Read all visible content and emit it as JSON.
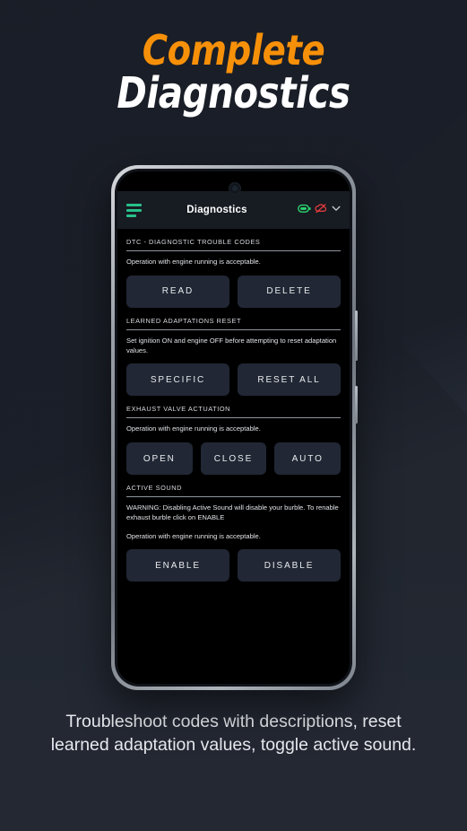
{
  "headline": {
    "line1": "Complete",
    "line2": "Diagnostics",
    "accent_color": "#F79009",
    "line2_color": "#FFFFFF"
  },
  "caption": "Troubleshoot codes with descriptions, reset learned adaptation values, toggle active sound.",
  "phone": {
    "app_bar": {
      "menu_icon": "hamburger-menu-icon",
      "menu_color": "#27C08A",
      "title": "Diagnostics",
      "status_icons": [
        {
          "name": "battery-icon",
          "color": "#2BD46F"
        },
        {
          "name": "cloud-off-icon",
          "color": "#E03C3C"
        },
        {
          "name": "chevron-down-icon",
          "color": "#C9CCD2"
        }
      ]
    },
    "sections": [
      {
        "title": "DTC - DIAGNOSTIC TROUBLE CODES",
        "description": "Operation with engine running is acceptable.",
        "warning": "",
        "buttons": [
          "READ",
          "DELETE"
        ]
      },
      {
        "title": "LEARNED ADAPTATIONS RESET",
        "description": "Set ignition ON and engine OFF before attempting to reset adaptation values.",
        "warning": "",
        "buttons": [
          "SPECIFIC",
          "RESET ALL"
        ]
      },
      {
        "title": "EXHAUST VALVE ACTUATION",
        "description": "Operation with engine running is acceptable.",
        "warning": "",
        "buttons": [
          "OPEN",
          "CLOSE",
          "AUTO"
        ]
      },
      {
        "title": "ACTIVE SOUND",
        "warning": "WARNING: Disabling Active Sound will disable your burble. To renable exhaust burble click on ENABLE",
        "description": "Operation with engine running is acceptable.",
        "buttons": [
          "ENABLE",
          "DISABLE"
        ]
      }
    ]
  }
}
